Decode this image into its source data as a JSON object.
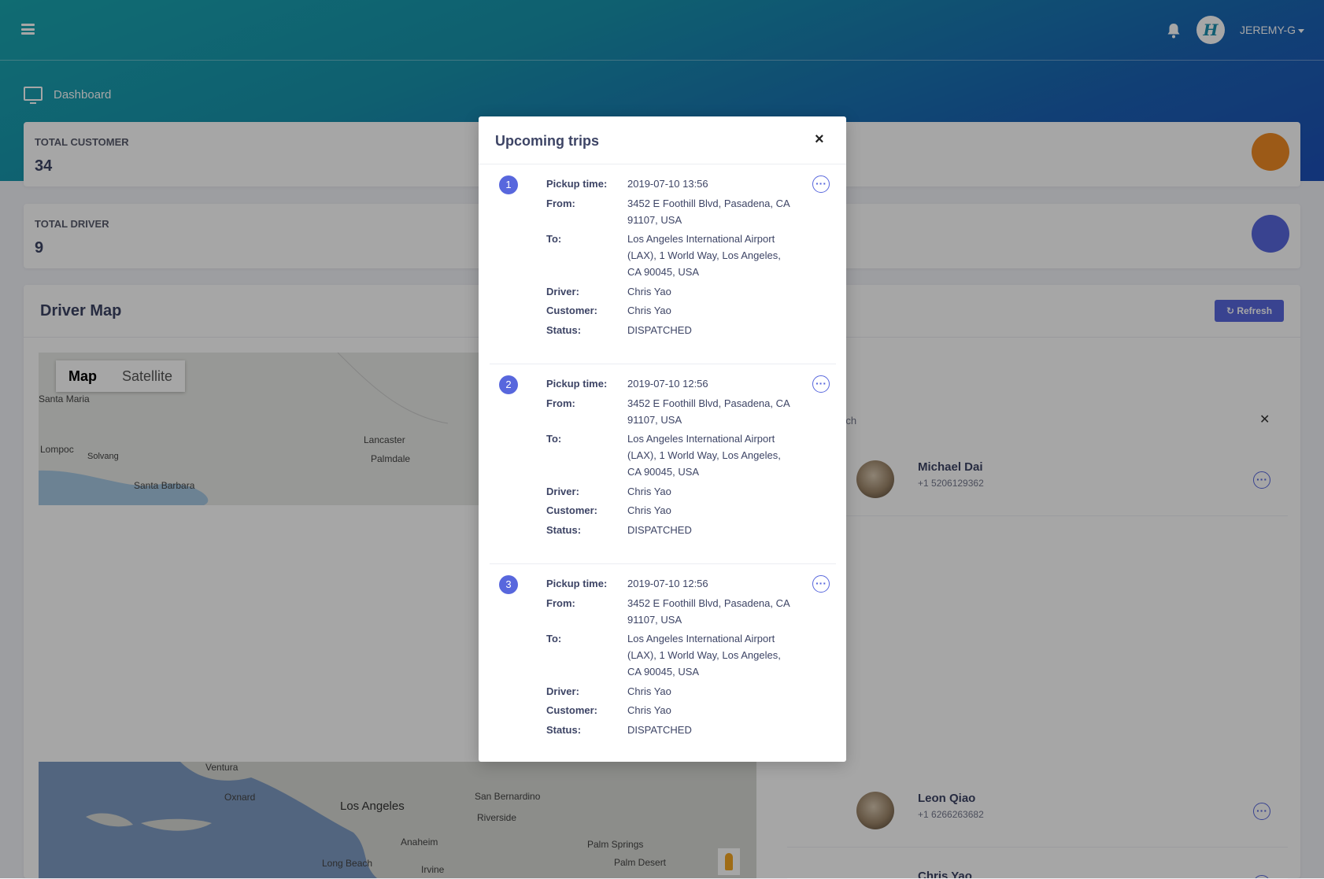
{
  "header": {
    "user": "JEREMY-G",
    "logo_text": "H"
  },
  "breadcrumb": {
    "label": "Dashboard"
  },
  "stats": [
    {
      "label": "TOTAL CUSTOMER",
      "value": "34"
    },
    {
      "label": "TOTAL DRIVER",
      "value": "9"
    }
  ],
  "driver_map": {
    "title": "Driver Map",
    "refresh_label": "Refresh"
  },
  "map": {
    "type_map": "Map",
    "type_satellite": "Satellite",
    "labels_top": [
      "Santa Maria",
      "Lompoc",
      "Solvang",
      "Santa Barbara",
      "Lancaster",
      "Palmdale"
    ],
    "labels_bottom": [
      "Ventura",
      "Oxnard",
      "Los Angeles",
      "San Bernardino",
      "Riverside",
      "Anaheim",
      "Long Beach",
      "Irvine",
      "Palm Springs",
      "Palm Desert"
    ]
  },
  "search": {
    "placeholder_fragment": "rch"
  },
  "drivers": [
    {
      "name": "Michael Dai",
      "phone": "+1 5206129362"
    },
    {
      "name": "Leon Qiao",
      "phone": "+1 6266263682"
    },
    {
      "name": "Chris Yao",
      "phone": ""
    }
  ],
  "modal": {
    "title": "Upcoming trips",
    "close": "×",
    "labels": {
      "pickup": "Pickup time:",
      "from": "From:",
      "to": "To:",
      "driver": "Driver:",
      "customer": "Customer:",
      "status": "Status:"
    },
    "trips": [
      {
        "num": "1",
        "pickup": "2019-07-10 13:56",
        "from": "3452 E Foothill Blvd, Pasadena, CA 91107, USA",
        "to": "Los Angeles International Airport (LAX), 1 World Way, Los Angeles, CA 90045, USA",
        "driver": "Chris Yao",
        "customer": "Chris Yao",
        "status": "DISPATCHED"
      },
      {
        "num": "2",
        "pickup": "2019-07-10 12:56",
        "from": "3452 E Foothill Blvd, Pasadena, CA 91107, USA",
        "to": "Los Angeles International Airport (LAX), 1 World Way, Los Angeles, CA 90045, USA",
        "driver": "Chris Yao",
        "customer": "Chris Yao",
        "status": "DISPATCHED"
      },
      {
        "num": "3",
        "pickup": "2019-07-10 12:56",
        "from": "3452 E Foothill Blvd, Pasadena, CA 91107, USA",
        "to": "Los Angeles International Airport (LAX), 1 World Way, Los Angeles, CA 90045, USA",
        "driver": "Chris Yao",
        "customer": "Chris Yao",
        "status": "DISPATCHED"
      }
    ]
  },
  "colors": {
    "accent": "#5867dd",
    "hero_start": "#1aa6b0",
    "hero_end": "#1d4fb8",
    "stat_orange": "#f08a24",
    "stat_purple": "#5867dd"
  }
}
